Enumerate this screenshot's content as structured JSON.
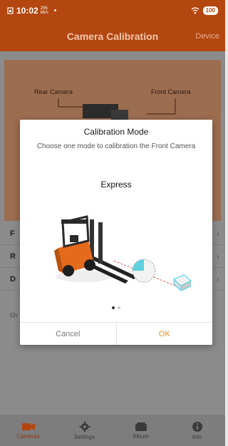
{
  "status_bar": {
    "time": "10:02",
    "net_top": "256",
    "net_bottom": "kb/s",
    "dot": "•",
    "battery": "100"
  },
  "header": {
    "title": "Camera Calibration",
    "device": "Device"
  },
  "background_card": {
    "rear_label": "Rear Camera",
    "front_label": "Front Camera"
  },
  "list": {
    "rows": [
      {
        "label": "F",
        "arrow": "›"
      },
      {
        "label": "R",
        "arrow": "›"
      },
      {
        "label": "D",
        "arrow": "›"
      }
    ],
    "footer_text": "Ch"
  },
  "tabs": [
    {
      "label": "Cameras",
      "icon": "camera-icon"
    },
    {
      "label": "Settings",
      "icon": "gear-icon"
    },
    {
      "label": "Album",
      "icon": "album-icon"
    },
    {
      "label": "Info",
      "icon": "info-icon"
    }
  ],
  "dialog": {
    "title": "Calibration Mode",
    "subtitle": "Choose one mode to calibration the Front Camera",
    "mode_name": "Express",
    "page_count": 2,
    "current_page": 1,
    "cancel_label": "Cancel",
    "ok_label": "OK"
  },
  "colors": {
    "header": "#b3470f",
    "ok": "#e6951e",
    "accent_cyan": "#3fd6e6"
  }
}
